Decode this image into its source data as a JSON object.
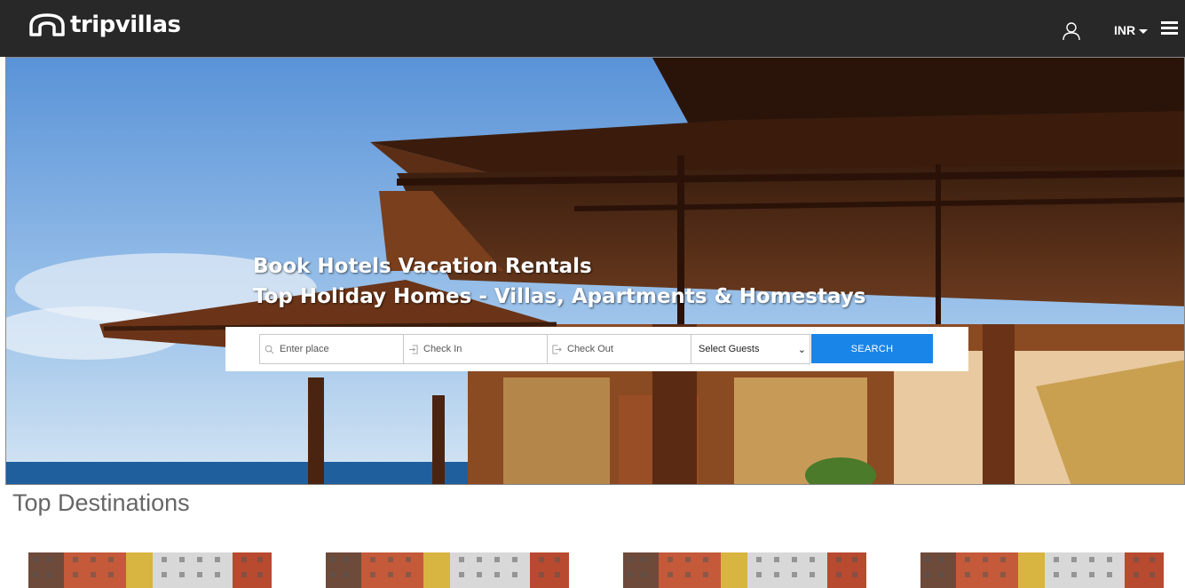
{
  "header": {
    "logo_text": "tripvillas",
    "currency": "INR",
    "background": "#282828"
  },
  "hero": {
    "title_line1": "Book Hotels Vacation Rentals",
    "title_line2": "Top Holiday Homes - Villas, Apartments & Homestays"
  },
  "search": {
    "place_placeholder": "Enter place",
    "checkin_placeholder": "Check In",
    "checkout_placeholder": "Check Out",
    "guests_selected": "Select Guests",
    "button_label": "SEARCH",
    "button_color": "#1a85e8"
  },
  "destinations": {
    "title": "Top Destinations",
    "cards": [
      {
        "image": "building-photo"
      },
      {
        "image": "building-photo"
      },
      {
        "image": "building-photo"
      },
      {
        "image": "building-photo"
      }
    ]
  },
  "icons": {
    "user": "user-icon",
    "menu": "hamburger-menu-icon",
    "search": "search-icon",
    "checkin": "login-arrow-icon",
    "checkout": "logout-arrow-icon"
  }
}
